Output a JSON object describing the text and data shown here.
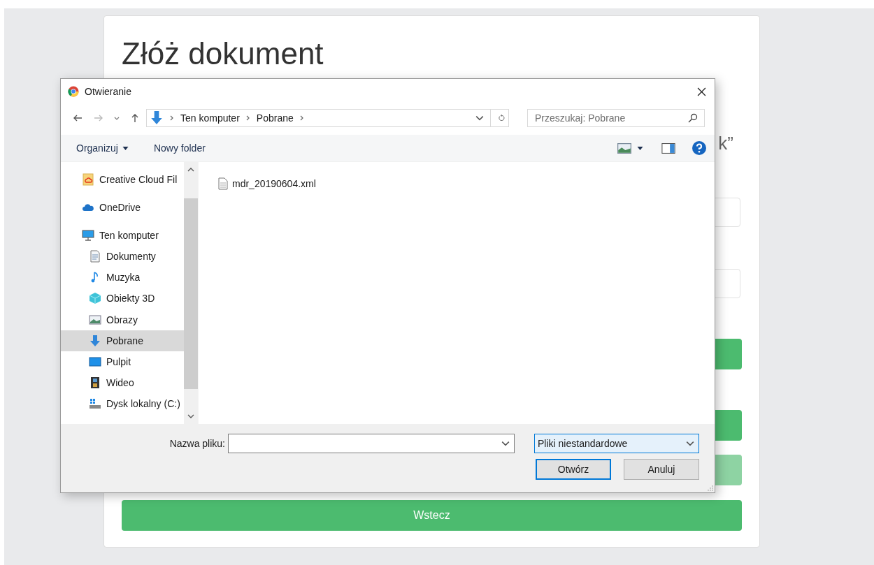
{
  "page": {
    "title": "Złóż dokument",
    "cut_text": "k”",
    "hidden_buttons": [
      {
        "disabled": false
      },
      {
        "disabled": false
      },
      {
        "disabled": true
      }
    ],
    "back_button": "Wstecz"
  },
  "dialog": {
    "title": "Otwieranie",
    "breadcrumb": [
      "Ten komputer",
      "Pobrane"
    ],
    "search": {
      "placeholder": "Przeszukaj: Pobrane"
    },
    "toolbar": {
      "organize": "Organizuj",
      "new_folder": "Nowy folder"
    },
    "nav_items": [
      {
        "label": "Creative Cloud Fil",
        "kind": "creative-cloud",
        "selected": false
      },
      {
        "label": "OneDrive",
        "kind": "cloud",
        "selected": false
      },
      {
        "label": "Ten komputer",
        "kind": "computer",
        "selected": false,
        "children": [
          {
            "label": "Dokumenty",
            "kind": "documents",
            "selected": false
          },
          {
            "label": "Muzyka",
            "kind": "music",
            "selected": false
          },
          {
            "label": "Obiekty 3D",
            "kind": "cube",
            "selected": false
          },
          {
            "label": "Obrazy",
            "kind": "pictures",
            "selected": false
          },
          {
            "label": "Pobrane",
            "kind": "download",
            "selected": true
          },
          {
            "label": "Pulpit",
            "kind": "desktop",
            "selected": false
          },
          {
            "label": "Wideo",
            "kind": "video",
            "selected": false
          },
          {
            "label": "Dysk lokalny (C:)",
            "kind": "drive",
            "selected": false
          }
        ]
      }
    ],
    "files": [
      {
        "name": "mdr_20190604.xml",
        "selected": false
      }
    ],
    "filename_label": "Nazwa pliku:",
    "filetype": "Pliki niestandardowe",
    "open_button": "Otwórz",
    "cancel_button": "Anuluj"
  }
}
